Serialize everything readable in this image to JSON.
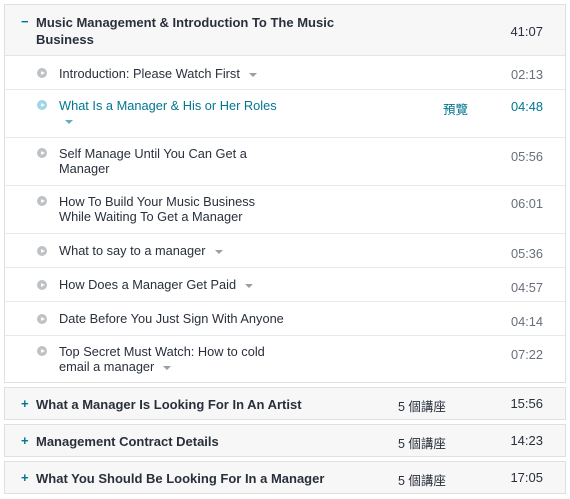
{
  "sections": [
    {
      "title_line1": "Music Management & Introduction To The Music",
      "title_line2": "Business",
      "duration": "41:07",
      "toggle": "−",
      "lectures": [
        {
          "title": "Introduction: Please Watch First",
          "duration": "02:13"
        },
        {
          "title": "What Is a Manager & His or Her Roles",
          "duration": "04:48",
          "preview": "預覽"
        },
        {
          "title_line1": "Self Manage Until You Can Get a",
          "title_line2": "Manager",
          "duration": "05:56"
        },
        {
          "title_line1": "How To Build Your Music Business",
          "title_line2": "While Waiting To Get a Manager",
          "duration": "06:01"
        },
        {
          "title": "What to say to a manager",
          "duration": "05:36"
        },
        {
          "title": "How Does a Manager Get Paid",
          "duration": "04:57"
        },
        {
          "title": "Date Before You Just Sign With Anyone",
          "duration": "04:14"
        },
        {
          "title_line1": "Top Secret Must Watch: How to cold",
          "title_line2": "email a manager",
          "duration": "07:22"
        }
      ]
    },
    {
      "title": "What a Manager Is Looking For In An Artist",
      "count": "5 個講座",
      "duration": "15:56",
      "toggle": "+"
    },
    {
      "title": "Management Contract Details",
      "count": "5 個講座",
      "duration": "14:23",
      "toggle": "+"
    },
    {
      "title": "What You Should Be Looking For In a Manager",
      "count": "5 個講座",
      "duration": "17:05",
      "toggle": "+"
    }
  ],
  "colors": {
    "accent": "#007791",
    "header_bg": "#f7f7f8",
    "border": "#e0e0e0"
  }
}
